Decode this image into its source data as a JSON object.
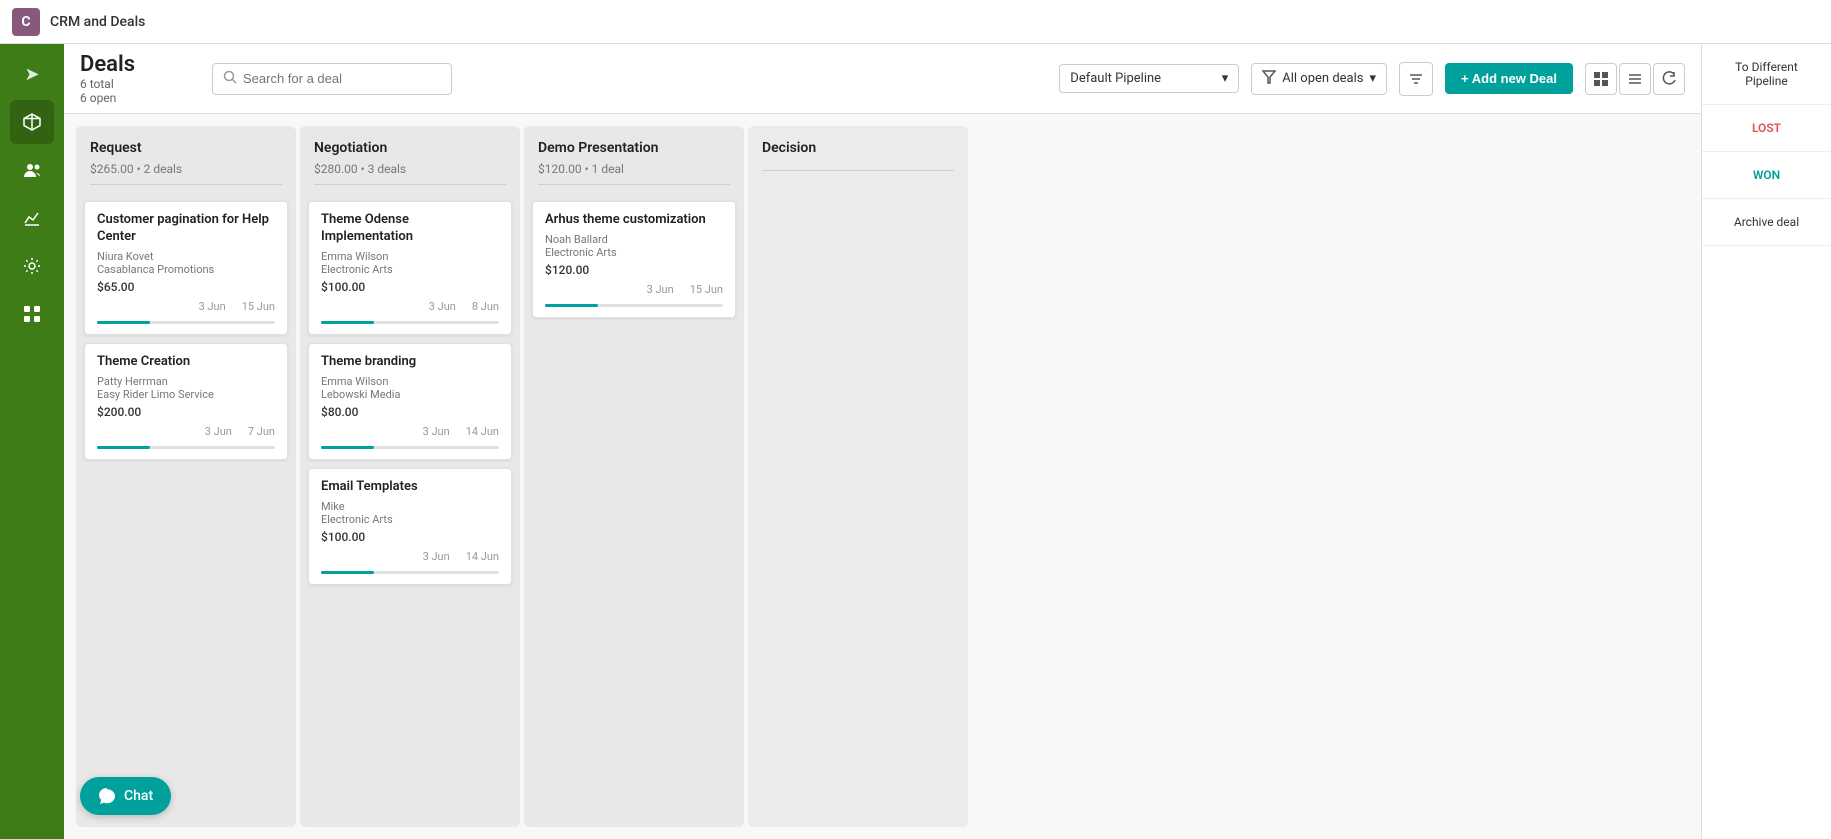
{
  "app": {
    "title": "CRM and Deals",
    "logo_letter": "C"
  },
  "topbar": {
    "title": "CRM and Deals"
  },
  "sidebar": {
    "items": [
      {
        "name": "nav-send",
        "icon": "➤",
        "label": "Send"
      },
      {
        "name": "nav-cube",
        "icon": "⬡",
        "label": "Products"
      },
      {
        "name": "nav-users",
        "icon": "👥",
        "label": "Users"
      },
      {
        "name": "nav-chart",
        "icon": "📈",
        "label": "Reports"
      },
      {
        "name": "nav-settings",
        "icon": "⚙",
        "label": "Settings"
      },
      {
        "name": "nav-grid",
        "icon": "⊞",
        "label": "Apps"
      }
    ]
  },
  "header": {
    "page_title": "Deals",
    "total_label": "6 total",
    "open_label": "6 open",
    "search_placeholder": "Search for a deal",
    "pipeline_label": "Default Pipeline",
    "filter_label": "All open deals",
    "add_deal_label": "+ Add new Deal"
  },
  "view_buttons": [
    {
      "name": "kanban-view",
      "icon": "▦",
      "label": "Kanban"
    },
    {
      "name": "list-view",
      "icon": "≡",
      "label": "List"
    },
    {
      "name": "refresh-view",
      "icon": "↺",
      "label": "Refresh"
    }
  ],
  "columns": [
    {
      "id": "request",
      "title": "Request",
      "summary": "$265.00 • 2 deals",
      "cards": [
        {
          "id": "card1",
          "title": "Customer pagination for Help Center",
          "contact": "Niura Kovet",
          "company": "Casablanca Promotions",
          "amount": "$65.00",
          "date_start": "3 Jun",
          "date_end": "15 Jun",
          "progress": 30
        },
        {
          "id": "card2",
          "title": "Theme Creation",
          "contact": "Patty Herrman",
          "company": "Easy Rider Limo Service",
          "amount": "$200.00",
          "date_start": "3 Jun",
          "date_end": "7 Jun",
          "progress": 30
        }
      ]
    },
    {
      "id": "negotiation",
      "title": "Negotiation",
      "summary": "$280.00 • 3 deals",
      "cards": [
        {
          "id": "card3",
          "title": "Theme Odense Implementation",
          "contact": "Emma Wilson",
          "company": "Electronic Arts",
          "amount": "$100.00",
          "date_start": "3 Jun",
          "date_end": "8 Jun",
          "progress": 30
        },
        {
          "id": "card4",
          "title": "Theme branding",
          "contact": "Emma Wilson",
          "company": "Lebowski Media",
          "amount": "$80.00",
          "date_start": "3 Jun",
          "date_end": "14 Jun",
          "progress": 30
        },
        {
          "id": "card5",
          "title": "Email Templates",
          "contact": "Mike",
          "company": "Electronic Arts",
          "amount": "$100.00",
          "date_start": "3 Jun",
          "date_end": "14 Jun",
          "progress": 30
        }
      ]
    },
    {
      "id": "demo-presentation",
      "title": "Demo Presentation",
      "summary": "$120.00 • 1 deal",
      "cards": [
        {
          "id": "card6",
          "title": "Arhus theme customization",
          "contact": "Noah Ballard",
          "company": "Electronic Arts",
          "amount": "$120.00",
          "date_start": "3 Jun",
          "date_end": "15 Jun",
          "progress": 30
        }
      ]
    },
    {
      "id": "decision",
      "title": "Decision",
      "summary": "",
      "cards": []
    }
  ],
  "right_panel": {
    "items": [
      {
        "id": "to-different-pipeline",
        "label": "To Different Pipeline",
        "style": "normal"
      },
      {
        "id": "lost",
        "label": "LOST",
        "style": "lost"
      },
      {
        "id": "won",
        "label": "WON",
        "style": "won"
      },
      {
        "id": "archive-deal",
        "label": "Archive deal",
        "style": "normal"
      }
    ]
  },
  "chat": {
    "label": "Chat"
  }
}
